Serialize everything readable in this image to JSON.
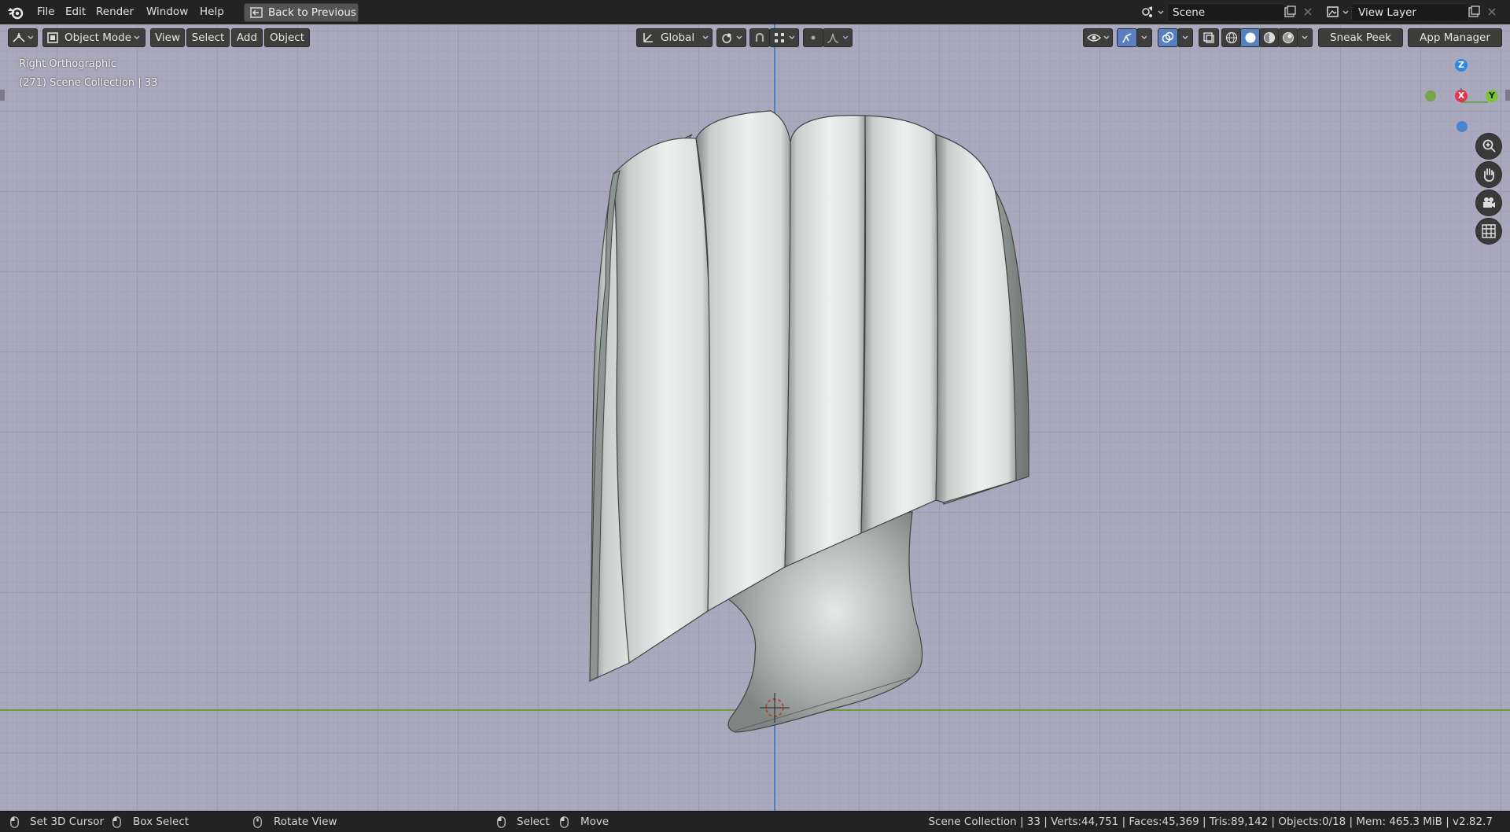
{
  "menubar": {
    "items": [
      "File",
      "Edit",
      "Render",
      "Window",
      "Help"
    ],
    "back_label": "Back to Previous",
    "scene_value": "Scene",
    "view_layer_value": "View Layer"
  },
  "header": {
    "mode_label": "Object Mode",
    "menus": [
      "View",
      "Select",
      "Add",
      "Object"
    ],
    "transform_orientation": "Global",
    "sneak_peek_label": "Sneak Peek",
    "app_manager_label": "App Manager"
  },
  "viewport": {
    "view_name": "Right Orthographic",
    "collection_info": "(271) Scene Collection | 33",
    "gizmo": {
      "z": "Z",
      "x": "X",
      "y": "Y"
    },
    "colors": {
      "background": "#aaa8bd",
      "z_axis": "#4a7fc4",
      "y_axis": "#6c9a3c",
      "x_axis": "#e0364a"
    }
  },
  "statusbar": {
    "set_cursor": "Set 3D Cursor",
    "box_select": "Box Select",
    "rotate_view": "Rotate View",
    "select": "Select",
    "move": "Move",
    "stats": "Scene Collection | 33 | Verts:44,751 | Faces:45,369 | Tris:89,142 | Objects:0/18 | Mem: 465.3 MiB | v2.82.7"
  },
  "icons": [
    "blender-logo-icon",
    "back-icon",
    "scene-icon",
    "view-layer-icon",
    "editor-type-icon",
    "object-mode-icon",
    "orientation-icon",
    "pivot-icon",
    "snap-icon",
    "proportional-icon",
    "visibility-icon",
    "gizmo-icon",
    "overlay-icon",
    "xray-icon",
    "wireframe-shading-icon",
    "solid-shading-icon",
    "material-shading-icon",
    "rendered-shading-icon",
    "zoom-icon",
    "pan-hand-icon",
    "camera-icon",
    "grid-view-icon",
    "mouse-icon"
  ]
}
